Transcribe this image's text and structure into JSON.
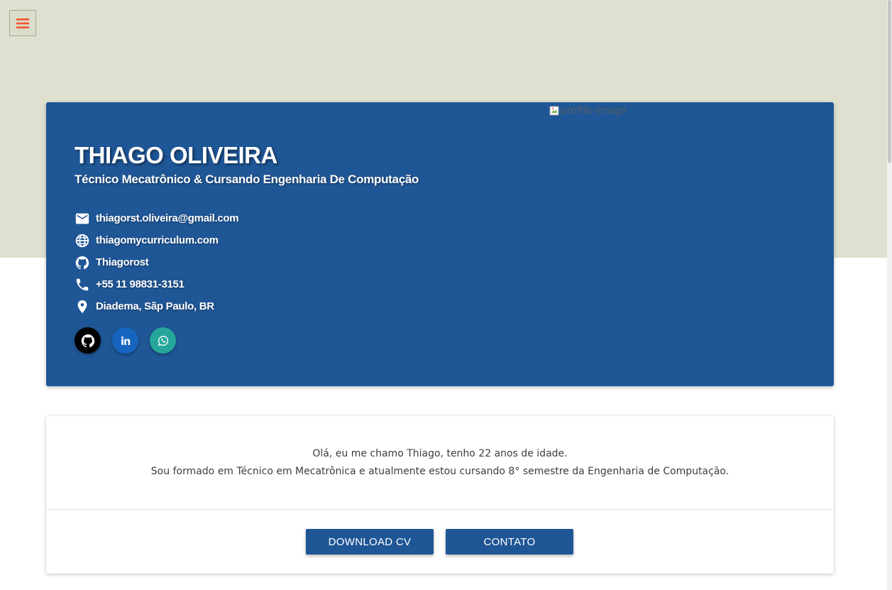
{
  "colors": {
    "top_band": "#dfe0cf",
    "hero_bg": "#1f5696",
    "menu_icon": "#f0552f",
    "github_bg": "#000000",
    "linkedin_bg": "#1565c0",
    "whatsapp_bg": "#26a69a",
    "button_bg": "#1f5696"
  },
  "nav": {
    "menu_icon": "hamburger-icon"
  },
  "profile": {
    "image_alt": "profile-image",
    "name": "THIAGO OLIVEIRA",
    "subtitle": "Técnico Mecatrônico & Cursando Engenharia De Computação"
  },
  "contacts": [
    {
      "icon": "email-icon",
      "text": "thiagorst.oliveira@gmail.com"
    },
    {
      "icon": "globe-icon",
      "text": "thiagomycurriculum.com"
    },
    {
      "icon": "github-icon",
      "text": "Thiagorost"
    },
    {
      "icon": "phone-icon",
      "text": "+55 11 98831-3151"
    },
    {
      "icon": "location-icon",
      "text": "Diadema, Sãp Paulo, BR"
    }
  ],
  "social": [
    {
      "icon": "github-icon",
      "label": "GitHub"
    },
    {
      "icon": "linkedin-icon",
      "label": "in"
    },
    {
      "icon": "whatsapp-icon",
      "label": "WhatsApp"
    }
  ],
  "about": {
    "line1": "Olá, eu me chamo Thiago, tenho 22 anos de idade.",
    "line2": "Sou formado em Técnico em Mecatrônica e atualmente estou cursando 8° semestre da Engenharia de Computação."
  },
  "actions": {
    "download_label": "DOWNLOAD CV",
    "contact_label": "CONTATO"
  }
}
